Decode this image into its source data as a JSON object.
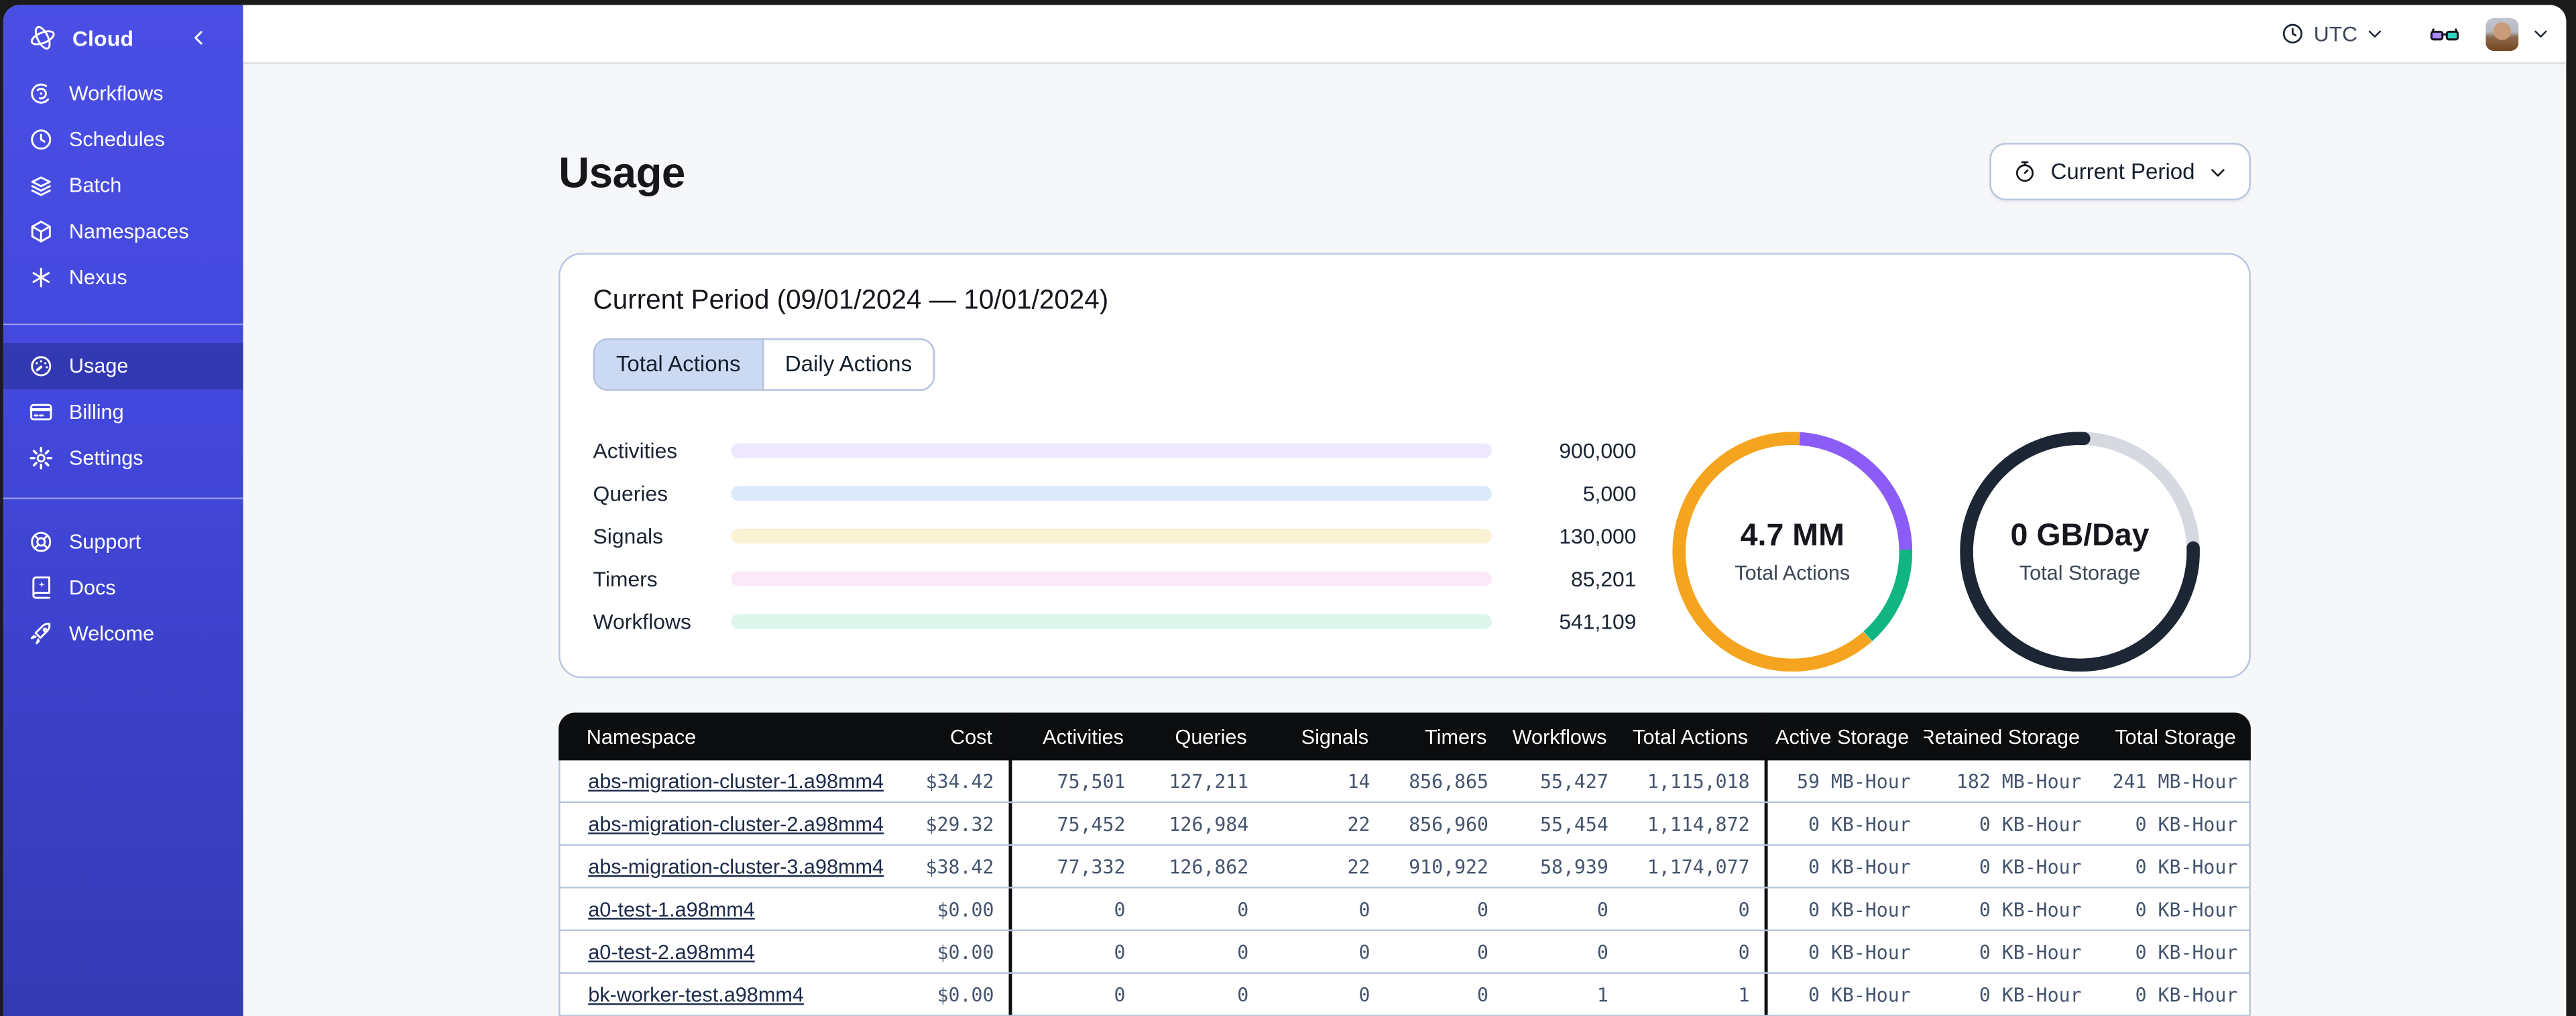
{
  "colors": {
    "sidebar_top": "#4a4fe4",
    "sidebar_bottom": "#333ab3",
    "selected_nav": "rgba(13,16,80,0.30)",
    "header_black": "#0c0d0f",
    "card_border": "#b9c5e0",
    "tab_selected_bg": "#ccd9f2",
    "row_divider": "#b7c3dc",
    "activities": "#8B5CF6",
    "activities_track": "#EDE8FD",
    "queries": "#4284F5",
    "queries_track": "#DCE8FC",
    "signals": "#F0A00F",
    "signals_track": "#FBF1D3",
    "timers": "#E8479B",
    "timers_track": "#FCE9F7",
    "workflows": "#11B581",
    "workflows_track": "#DCF6EB",
    "donut_orange": "#F5A41F",
    "donut_purple": "#8B5CF6",
    "donut_green": "#11B581",
    "donut_navy": "#1C2634",
    "donut_gray": "#D6D9DF"
  },
  "sidebar": {
    "brand": "Cloud",
    "collapse_icon": "chevron-left-icon",
    "groups": [
      {
        "items": [
          {
            "id": "workflows",
            "label": "Workflows",
            "icon": "workflows-icon",
            "selected": false
          },
          {
            "id": "schedules",
            "label": "Schedules",
            "icon": "schedules-icon",
            "selected": false
          },
          {
            "id": "batch",
            "label": "Batch",
            "icon": "batch-icon",
            "selected": false
          },
          {
            "id": "namespaces",
            "label": "Namespaces",
            "icon": "namespaces-icon",
            "selected": false
          },
          {
            "id": "nexus",
            "label": "Nexus",
            "icon": "nexus-icon",
            "selected": false
          }
        ]
      },
      {
        "items": [
          {
            "id": "usage",
            "label": "Usage",
            "icon": "gauge-icon",
            "selected": true
          },
          {
            "id": "billing",
            "label": "Billing",
            "icon": "credit-card-icon",
            "selected": false
          },
          {
            "id": "settings",
            "label": "Settings",
            "icon": "gear-icon",
            "selected": false
          }
        ]
      },
      {
        "items": [
          {
            "id": "support",
            "label": "Support",
            "icon": "lifebuoy-icon",
            "selected": false
          },
          {
            "id": "docs",
            "label": "Docs",
            "icon": "book-icon",
            "selected": false
          },
          {
            "id": "welcome",
            "label": "Welcome",
            "icon": "rocket-icon",
            "selected": false
          }
        ]
      }
    ]
  },
  "topbar": {
    "timezone": "UTC",
    "timezone_icon": "clock-icon",
    "glasses_icon": "glasses-icon",
    "avatar": "user-avatar"
  },
  "page": {
    "title": "Usage",
    "period_button_label": "Current Period",
    "period_button_icon": "stopwatch-icon"
  },
  "usage_card": {
    "title": "Current Period (09/01/2024 — 10/01/2024)",
    "tabs": [
      {
        "label": "Total Actions",
        "selected": true
      },
      {
        "label": "Daily Actions",
        "selected": false
      }
    ]
  },
  "chart_data": [
    {
      "type": "bar",
      "orientation": "horizontal",
      "categories": [
        "Activities",
        "Queries",
        "Signals",
        "Timers",
        "Workflows"
      ],
      "values": [
        900000,
        5000,
        130000,
        85201,
        541109
      ],
      "display_values": [
        "900,000",
        "5,000",
        "130,000",
        "85,201",
        "541,109"
      ],
      "fill_fractions": [
        0.893,
        0.067,
        0.26,
        0.152,
        0.44
      ],
      "bar_colors": [
        "#8B5CF6",
        "#4284F5",
        "#F0A00F",
        "#E8479B",
        "#11B581"
      ],
      "track_colors": [
        "#EDE8FD",
        "#DCE8FC",
        "#FBF1D3",
        "#FCE9F7",
        "#DCF6EB"
      ],
      "title": "",
      "xlabel": "",
      "ylabel": ""
    },
    {
      "type": "pie",
      "subtype": "donut",
      "center_value": "4.7 MM",
      "center_label": "Total Actions",
      "segments": [
        {
          "name": "purple-segment",
          "color": "#8B5CF6",
          "start_deg": 3.6,
          "percent": 23.7
        },
        {
          "name": "green-segment",
          "color": "#11B581",
          "start_deg": 88.9,
          "percent": 13.7
        },
        {
          "name": "orange-segment",
          "color": "#F5A41F",
          "start_deg": 138.4,
          "percent": 62.6
        }
      ]
    },
    {
      "type": "pie",
      "subtype": "donut-progress",
      "center_value": "0 GB/Day",
      "center_label": "Total Storage",
      "track_color": "#D6D9DF",
      "segments": [
        {
          "name": "storage-arc",
          "color": "#1C2634",
          "start_deg": 88,
          "percent": 76.1,
          "cap": "round"
        }
      ]
    }
  ],
  "table": {
    "columns": [
      "Namespace",
      "Cost",
      "Activities",
      "Queries",
      "Signals",
      "Timers",
      "Workflows",
      "Total Actions",
      "Active Storage",
      "Retained Storage",
      "Total Storage"
    ],
    "rows": [
      [
        "abs-migration-cluster-1.a98mm4",
        "$34.42",
        "75,501",
        "127,211",
        "14",
        "856,865",
        "55,427",
        "1,115,018",
        "59 MB-Hour",
        "182 MB-Hour",
        "241 MB-Hour"
      ],
      [
        "abs-migration-cluster-2.a98mm4",
        "$29.32",
        "75,452",
        "126,984",
        "22",
        "856,960",
        "55,454",
        "1,114,872",
        "0 KB-Hour",
        "0 KB-Hour",
        "0 KB-Hour"
      ],
      [
        "abs-migration-cluster-3.a98mm4",
        "$38.42",
        "77,332",
        "126,862",
        "22",
        "910,922",
        "58,939",
        "1,174,077",
        "0 KB-Hour",
        "0 KB-Hour",
        "0 KB-Hour"
      ],
      [
        "a0-test-1.a98mm4",
        "$0.00",
        "0",
        "0",
        "0",
        "0",
        "0",
        "0",
        "0 KB-Hour",
        "0 KB-Hour",
        "0 KB-Hour"
      ],
      [
        "a0-test-2.a98mm4",
        "$0.00",
        "0",
        "0",
        "0",
        "0",
        "0",
        "0",
        "0 KB-Hour",
        "0 KB-Hour",
        "0 KB-Hour"
      ],
      [
        "bk-worker-test.a98mm4",
        "$0.00",
        "0",
        "0",
        "0",
        "0",
        "1",
        "1",
        "0 KB-Hour",
        "0 KB-Hour",
        "0 KB-Hour"
      ]
    ]
  }
}
